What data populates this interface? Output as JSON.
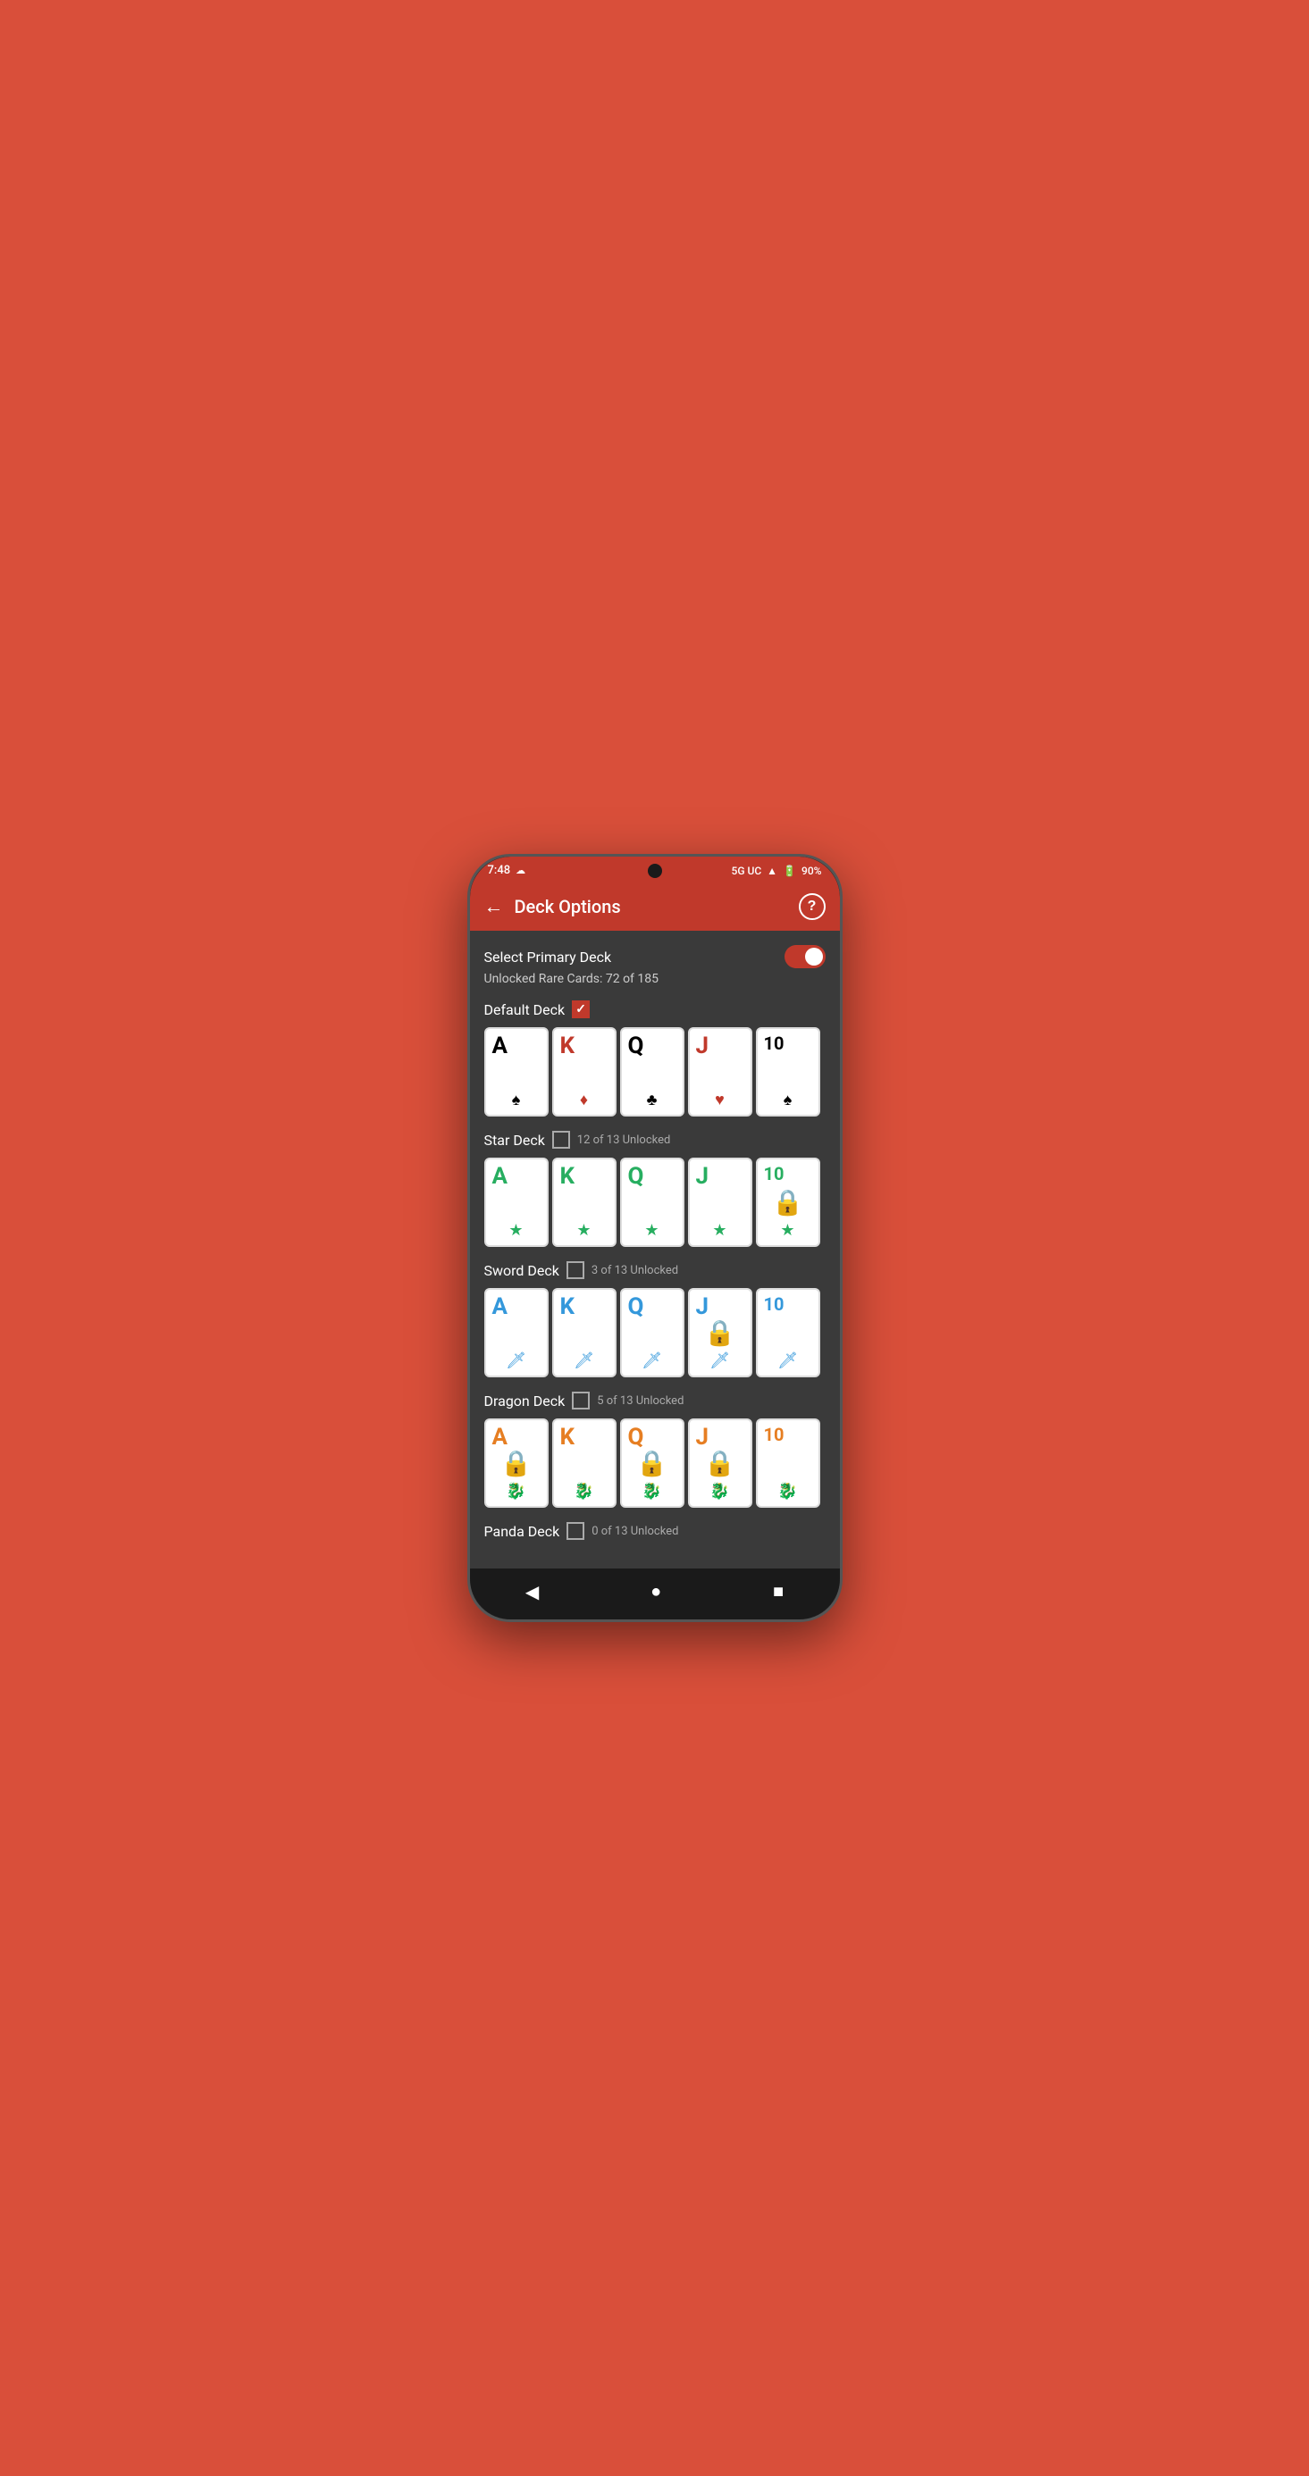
{
  "statusBar": {
    "time": "7:48",
    "signal": "5G UC",
    "battery": "90%"
  },
  "appBar": {
    "title": "Deck Options",
    "backLabel": "←",
    "helpLabel": "?"
  },
  "content": {
    "selectPrimaryDeckLabel": "Select Primary Deck",
    "unlockedRareCardsLabel": "Unlocked Rare Cards: 72 of 185",
    "decks": [
      {
        "name": "Default Deck",
        "checked": true,
        "unlockCount": null,
        "cards": [
          {
            "letter": "A",
            "suit": "♠",
            "color": "black",
            "locked": false
          },
          {
            "letter": "K",
            "suit": "♦",
            "color": "red",
            "locked": false
          },
          {
            "letter": "Q",
            "suit": "♣",
            "color": "black",
            "locked": false
          },
          {
            "letter": "J",
            "suit": "♥",
            "color": "red",
            "locked": false
          },
          {
            "letter": "10",
            "suit": "♠",
            "color": "black",
            "locked": false
          }
        ]
      },
      {
        "name": "Star Deck",
        "checked": false,
        "unlockCount": "12 of 13 Unlocked",
        "cards": [
          {
            "letter": "A",
            "suit": "★",
            "color": "green",
            "locked": false
          },
          {
            "letter": "K",
            "suit": "★",
            "color": "green",
            "locked": false
          },
          {
            "letter": "Q",
            "suit": "★",
            "color": "green",
            "locked": false
          },
          {
            "letter": "J",
            "suit": "★",
            "color": "green",
            "locked": false
          },
          {
            "letter": "10",
            "suit": "★",
            "color": "green",
            "locked": true
          }
        ]
      },
      {
        "name": "Sword Deck",
        "checked": false,
        "unlockCount": "3 of 13 Unlocked",
        "cards": [
          {
            "letter": "A",
            "suit": "🗡",
            "color": "blue",
            "locked": false
          },
          {
            "letter": "K",
            "suit": "🗡",
            "color": "blue",
            "locked": false
          },
          {
            "letter": "Q",
            "suit": "🗡",
            "color": "blue",
            "locked": false
          },
          {
            "letter": "J",
            "suit": "🗡",
            "color": "blue",
            "locked": true
          },
          {
            "letter": "10",
            "suit": "🗡",
            "color": "blue",
            "locked": false
          }
        ]
      },
      {
        "name": "Dragon Deck",
        "checked": false,
        "unlockCount": "5 of 13 Unlocked",
        "cards": [
          {
            "letter": "A",
            "suit": "🐉",
            "color": "orange",
            "locked": true
          },
          {
            "letter": "K",
            "suit": "🐉",
            "color": "orange",
            "locked": false
          },
          {
            "letter": "Q",
            "suit": "🐉",
            "color": "orange",
            "locked": true
          },
          {
            "letter": "J",
            "suit": "🐉",
            "color": "orange",
            "locked": true
          },
          {
            "letter": "10",
            "suit": "🐉",
            "color": "orange",
            "locked": false
          }
        ]
      },
      {
        "name": "Panda Deck",
        "checked": false,
        "unlockCount": "0 of 13 Unlocked",
        "cards": []
      }
    ]
  },
  "bottomNav": {
    "backLabel": "◀",
    "homeLabel": "●",
    "squareLabel": "■"
  }
}
